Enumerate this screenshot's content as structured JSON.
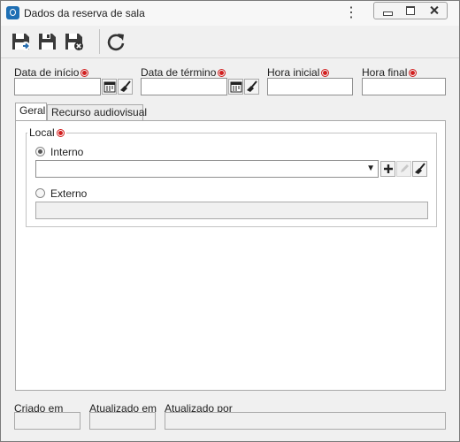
{
  "window": {
    "title": "Dados da reserva de sala",
    "icons": [
      "app-icon",
      "kebab-menu-icon",
      "minimize-icon",
      "maximize-icon",
      "close-icon"
    ]
  },
  "toolbar": {
    "buttons": [
      {
        "name": "save-and-new",
        "icon": "floppy-arrow-icon"
      },
      {
        "name": "save",
        "icon": "floppy-icon"
      },
      {
        "name": "save-and-close",
        "icon": "floppy-x-icon"
      },
      {
        "name": "refresh",
        "icon": "refresh-icon"
      }
    ]
  },
  "fields": {
    "start_date": {
      "label": "Data de início",
      "value": ""
    },
    "end_date": {
      "label": "Data de término",
      "value": ""
    },
    "start_time": {
      "label": "Hora inicial",
      "value": ""
    },
    "end_time": {
      "label": "Hora final",
      "value": ""
    }
  },
  "tabs": [
    {
      "label": "Geral",
      "active": true
    },
    {
      "label": "Recurso audiovisual",
      "active": false
    }
  ],
  "local": {
    "legend": "Local",
    "internal_label": "Interno",
    "internal_selected": true,
    "internal_value": "",
    "external_label": "Externo",
    "external_value": ""
  },
  "footer": {
    "created_label": "Criado em",
    "created_value": "",
    "updated_label": "Atualizado em",
    "updated_value": "",
    "updated_by_label": "Atualizado por",
    "updated_by_value": ""
  },
  "colors": {
    "required": "#d21f1f",
    "app_icon": "#1e6fb4",
    "floppy": "#3a3a3a",
    "save_new_accent": "#2a6fb0",
    "close_accent": "#333333"
  }
}
